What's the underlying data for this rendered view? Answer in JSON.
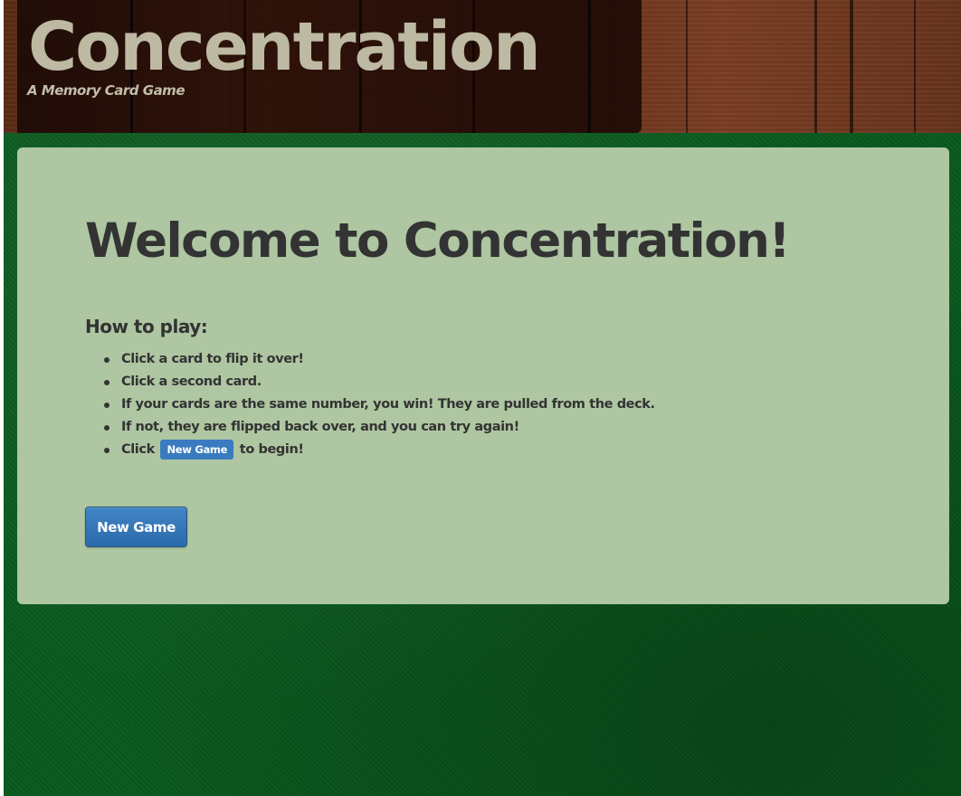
{
  "header": {
    "title": "Concentration",
    "subtitle": "A Memory Card Game"
  },
  "main": {
    "heading": "Welcome to Concentration!",
    "howto_heading": "How to play:",
    "rules": [
      "Click a card to flip it over!",
      "Click a second card.",
      "If your cards are the same number, you win! They are pulled from the deck.",
      "If not, they are flipped back over, and you can try again!"
    ],
    "last_rule": {
      "before": "Click",
      "button_label": "New Game",
      "after": "to begin!"
    },
    "new_game_button": "New Game"
  },
  "colors": {
    "felt_green": "#0a5a1e",
    "panel_bg": "#aec6a2",
    "button_blue": "#2b6aab",
    "title_text": "#bdb9a2",
    "body_text": "#333333"
  }
}
